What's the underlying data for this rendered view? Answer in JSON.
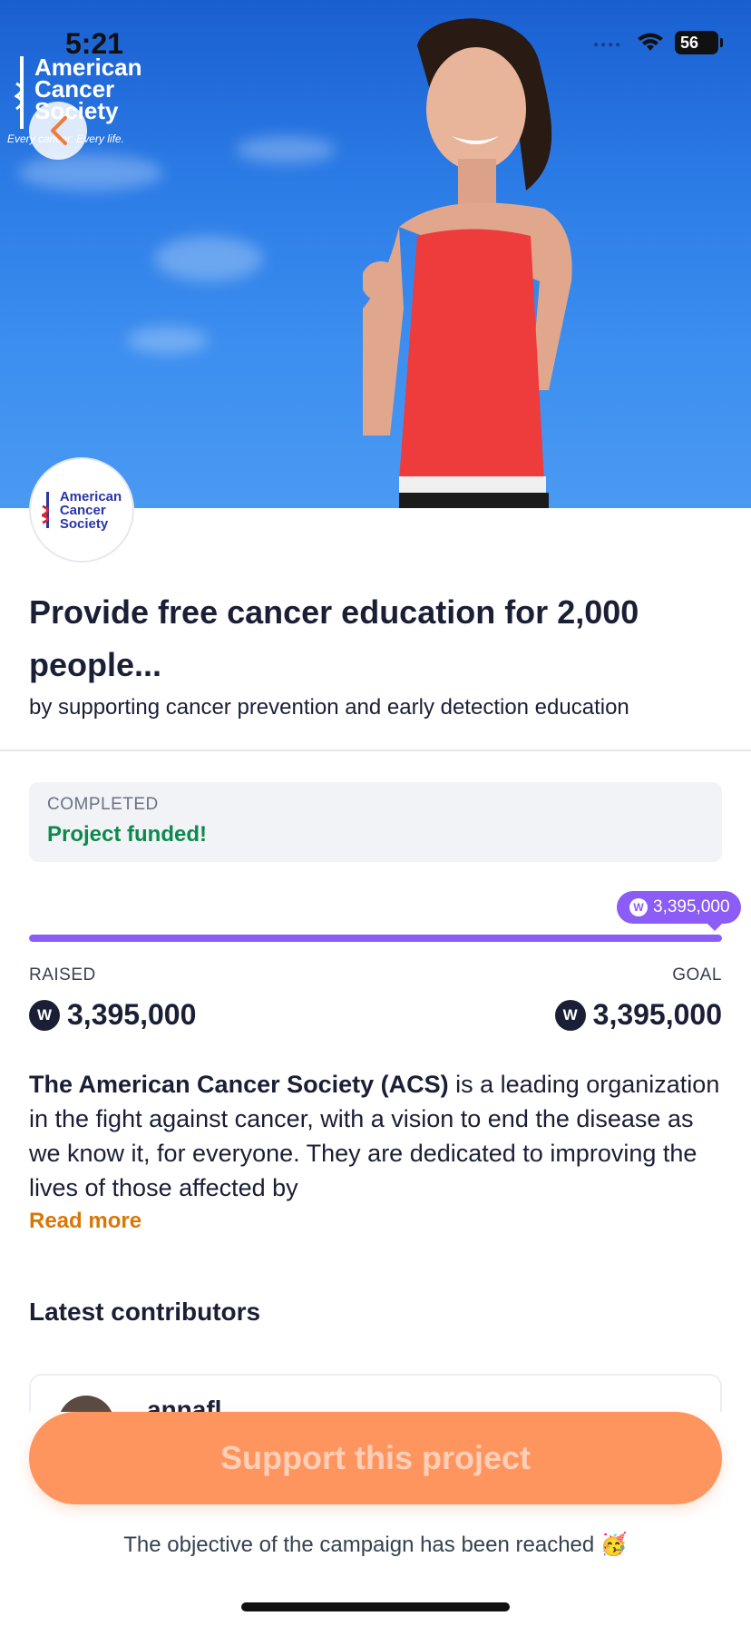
{
  "status_bar": {
    "time": "5:21",
    "battery": "56"
  },
  "hero": {
    "brand_lines": [
      "American",
      "Cancer",
      "Society"
    ],
    "brand_tagline": "Every cancer. Every life."
  },
  "org_logo": {
    "lines": [
      "American",
      "Cancer",
      "Society"
    ]
  },
  "project": {
    "title": "Provide free cancer education for 2,000 people...",
    "subtitle": "by supporting cancer prevention and early detection education"
  },
  "status_card": {
    "label": "COMPLETED",
    "value": "Project funded!"
  },
  "progress": {
    "bubble_amount": "3,395,000",
    "fraction": 1.0,
    "currency_glyph": "W",
    "raised_label": "RAISED",
    "goal_label": "GOAL",
    "raised_amount": "3,395,000",
    "goal_amount": "3,395,000"
  },
  "description": {
    "org_name": "The American Cancer Society (ACS)",
    "text": " is a leading organization in the fight against cancer, with a vision to end the disease as we know it, for everyone. They are dedicated to improving the lives of those affected by",
    "read_more": "Read more"
  },
  "contributors": {
    "title": "Latest contributors",
    "first_name": "annafl"
  },
  "cta": {
    "support_label": "Support this project",
    "reached_text": "The objective of the campaign has been reached 🥳"
  },
  "colors": {
    "accent_purple": "#8b5cf6",
    "cta_orange": "#fe955f",
    "success_green": "#0c8a4d",
    "link_orange": "#d97706"
  }
}
